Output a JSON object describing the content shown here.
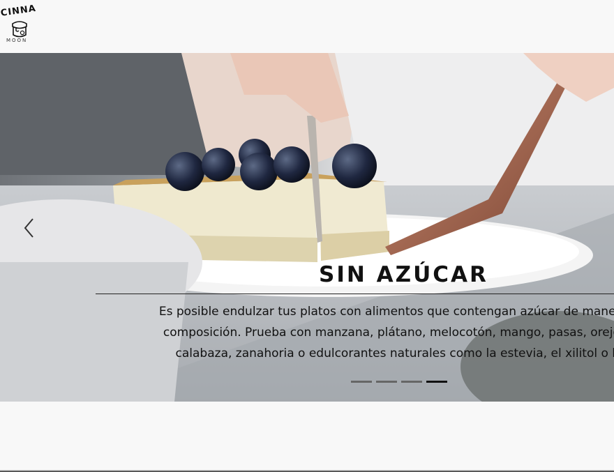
{
  "header": {
    "logo": {
      "text_top": "CINNA",
      "text_bottom": "MOON",
      "icon": "jar-icon"
    }
  },
  "carousel": {
    "prev_icon": "chevron-left-icon",
    "slide": {
      "title": "SIN AZÚCAR",
      "body_lines": [
        "Es posible endulzar tus platos con alimentos que contengan azúcar de manera n",
        "composición. Prueba con manzana, plátano, melocotón, mango, pasas, orejone",
        "calabaza, zanahoria o edulcorantes naturales como la estevia, el xilitol o la"
      ]
    },
    "indicators": [
      {
        "active": false
      },
      {
        "active": false
      },
      {
        "active": false
      },
      {
        "active": true
      }
    ]
  },
  "colors": {
    "page_background": "#f8f8f8",
    "text": "#111111",
    "indicator_inactive": "#666666",
    "indicator_active": "#111111"
  }
}
